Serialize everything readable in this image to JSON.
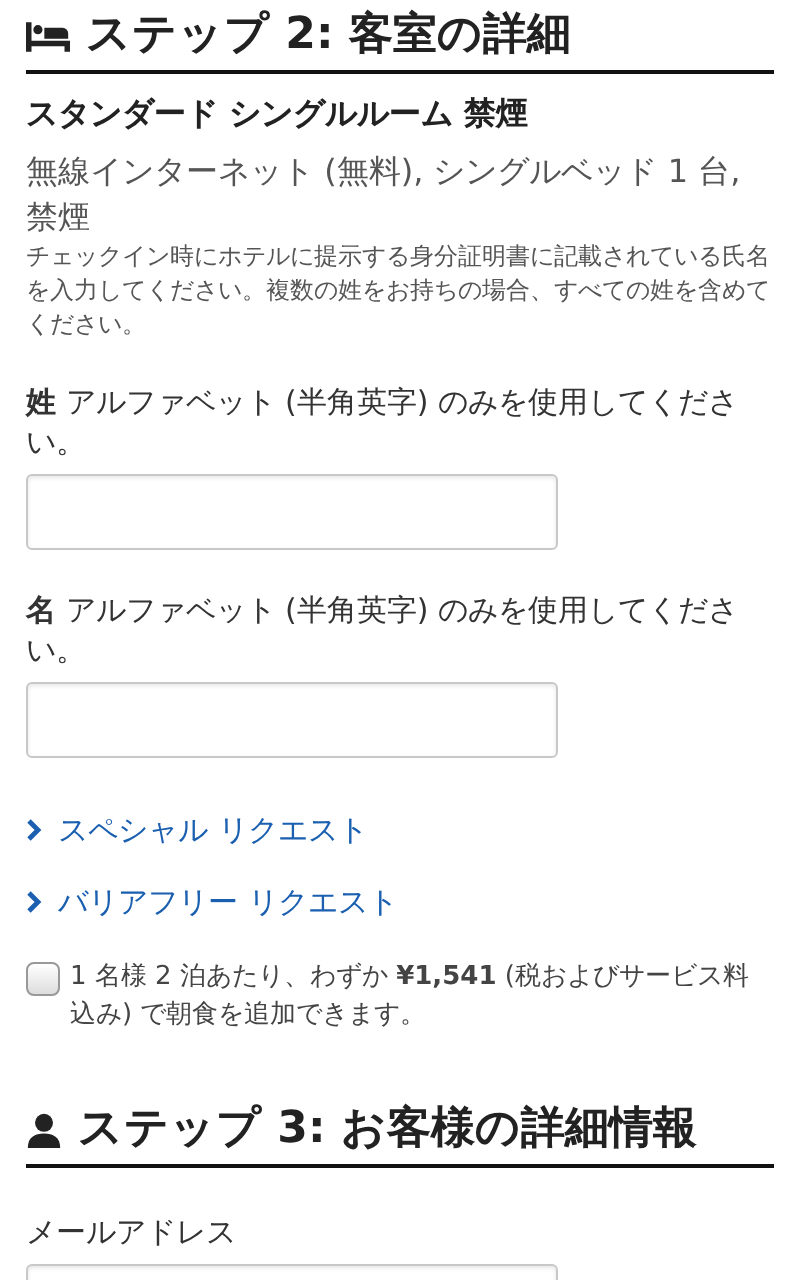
{
  "step2": {
    "title": "ステップ 2: 客室の詳細",
    "room_name": "スタンダード シングルルーム 禁煙",
    "amenities": "無線インターネット (無料), シングルベッド 1 台, 禁煙",
    "notice": "チェックイン時にホテルに提示する身分証明書に記載されている氏名を入力してください。複数の姓をお持ちの場合、すべての姓を含めてください。",
    "fields": [
      {
        "label": "**姓** アルファベット (半角英字) のみを使用してください。"
      },
      {
        "label": "**名** アルファベット (半角英字) のみを使用してください。"
      }
    ],
    "links": [
      {
        "label": "スペシャル リクエスト"
      },
      {
        "label": "バリアフリー リクエスト"
      }
    ],
    "breakfast": {
      "checked": false,
      "label": "1 名様 2 泊あたり、わずか **¥1,541** (税およびサービス料込み) で朝食を追加できます。"
    }
  },
  "step3": {
    "title": "ステップ 3: お客様の詳細情報",
    "fields": [
      {
        "label": "メールアドレス"
      }
    ]
  }
}
